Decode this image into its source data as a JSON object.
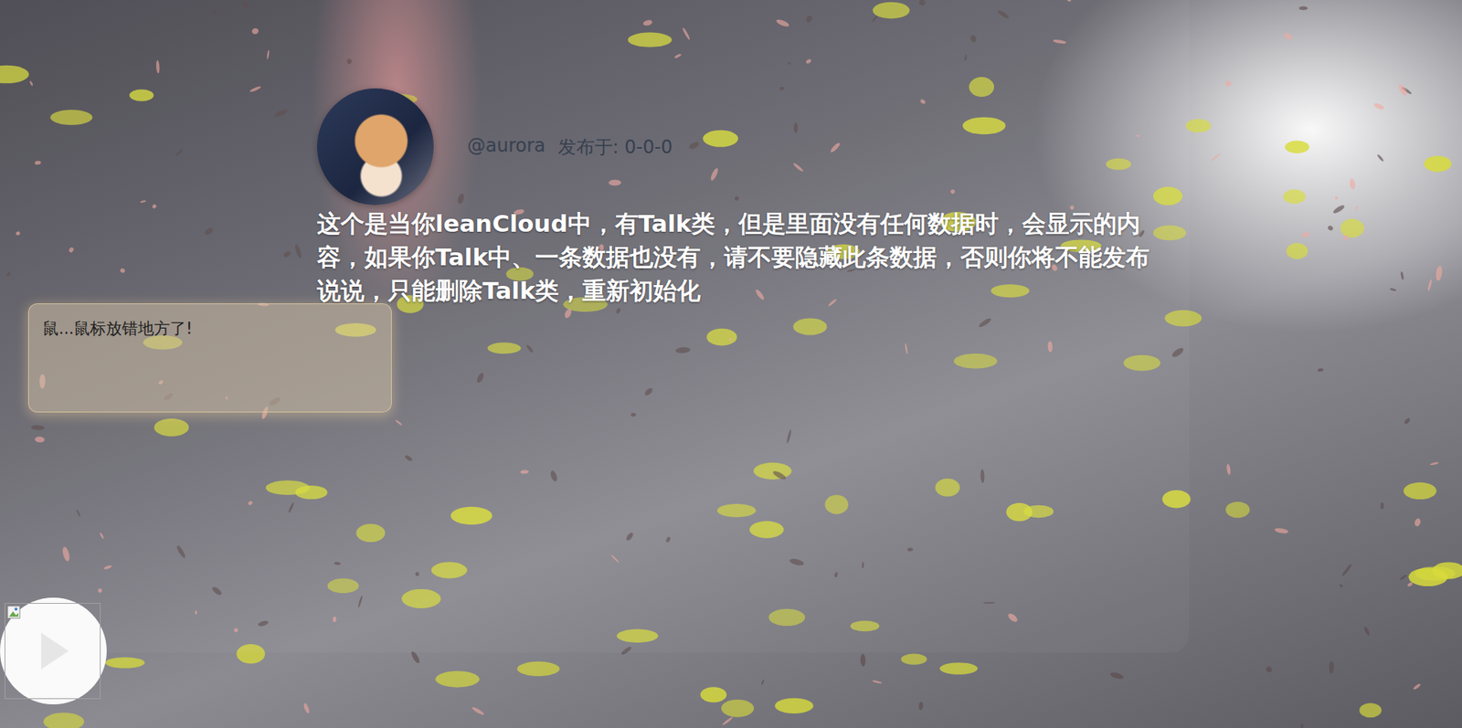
{
  "post": {
    "author": "@aurora",
    "published": "发布于: 0-0-0",
    "content": "这个是当你leanCloud中，有Talk类，但是里面没有任何数据时，会显示的内容，如果你Talk中、一条数据也没有，请不要隐藏此条数据，否则你将不能发布说说，只能删除Talk类，重新初始化"
  },
  "tooltip": {
    "text": "鼠...鼠标放错地方了!"
  },
  "player": {
    "playing": false
  }
}
